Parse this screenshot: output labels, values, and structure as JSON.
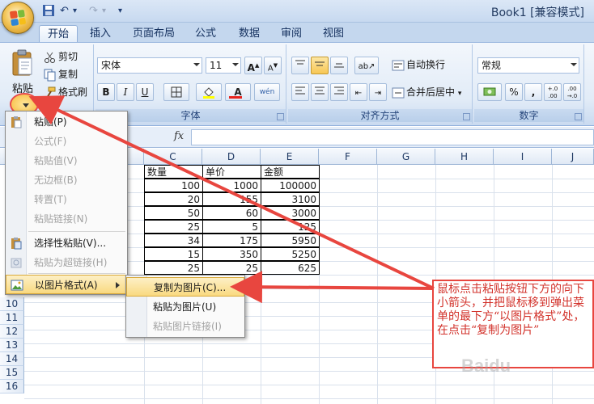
{
  "window": {
    "title": "Book1  [兼容模式]"
  },
  "quick_access": {
    "undo_glyph": "↶",
    "redo_glyph": "↷",
    "more_glyph": "▾"
  },
  "tabs": [
    "开始",
    "插入",
    "页面布局",
    "公式",
    "数据",
    "审阅",
    "视图"
  ],
  "clipboard": {
    "paste_label": "粘贴",
    "cut_label": "剪切",
    "copy_label": "复制",
    "format_painter_label": "格式刷"
  },
  "font": {
    "family_value": "宋体",
    "size_value": "11",
    "group_label": "字体",
    "bold": "B",
    "italic": "I",
    "underline": "U",
    "grow": "A",
    "shrink": "A",
    "font_color_glyph": "A",
    "phonetic_glyph": "wén"
  },
  "alignment": {
    "wrap_label": "自动换行",
    "merge_label": "合并后居中",
    "group_label": "对齐方式"
  },
  "number": {
    "format_value": "常规",
    "percent": "%",
    "comma": ",",
    "inc_decimal": "+.0 .00",
    "dec_decimal": ".00 →.0",
    "group_label": "数字"
  },
  "formula_bar": {
    "fx": "fx"
  },
  "columns": [
    "C",
    "D",
    "E",
    "F",
    "G",
    "H",
    "I",
    "J"
  ],
  "rows": [
    "10",
    "11",
    "12",
    "13",
    "14",
    "15",
    "16"
  ],
  "table": {
    "headers": [
      "数量",
      "单价",
      "金额"
    ],
    "rows": [
      [
        "100",
        "1000",
        "100000"
      ],
      [
        "20",
        "155",
        "3100"
      ],
      [
        "50",
        "60",
        "3000"
      ],
      [
        "25",
        "5",
        "125"
      ],
      [
        "34",
        "175",
        "5950"
      ],
      [
        "15",
        "350",
        "5250"
      ],
      [
        "25",
        "25",
        "625"
      ]
    ]
  },
  "paste_menu": {
    "items": [
      {
        "label": "粘贴(P)",
        "enabled": true
      },
      {
        "label": "公式(F)",
        "enabled": false
      },
      {
        "label": "粘贴值(V)",
        "enabled": false
      },
      {
        "label": "无边框(B)",
        "enabled": false
      },
      {
        "label": "转置(T)",
        "enabled": false
      },
      {
        "label": "粘贴链接(N)",
        "enabled": false
      },
      {
        "label": "选择性粘贴(V)...",
        "enabled": true
      },
      {
        "label": "粘贴为超链接(H)",
        "enabled": false
      },
      {
        "label": "以图片格式(A)",
        "enabled": true,
        "highlighted": true
      }
    ]
  },
  "picture_submenu": {
    "items": [
      {
        "label": "复制为图片(C)...",
        "enabled": true,
        "highlighted": true
      },
      {
        "label": "粘贴为图片(U)",
        "enabled": true
      },
      {
        "label": "粘贴图片链接(I)",
        "enabled": false
      }
    ]
  },
  "annotation": {
    "text": "鼠标点击粘贴按钮下方的向下小箭头，并把鼠标移到弹出菜单的最下方“以图片格式”处，在点击“复制为图片”",
    "color": "#e8463f"
  },
  "watermark": "Baidu"
}
